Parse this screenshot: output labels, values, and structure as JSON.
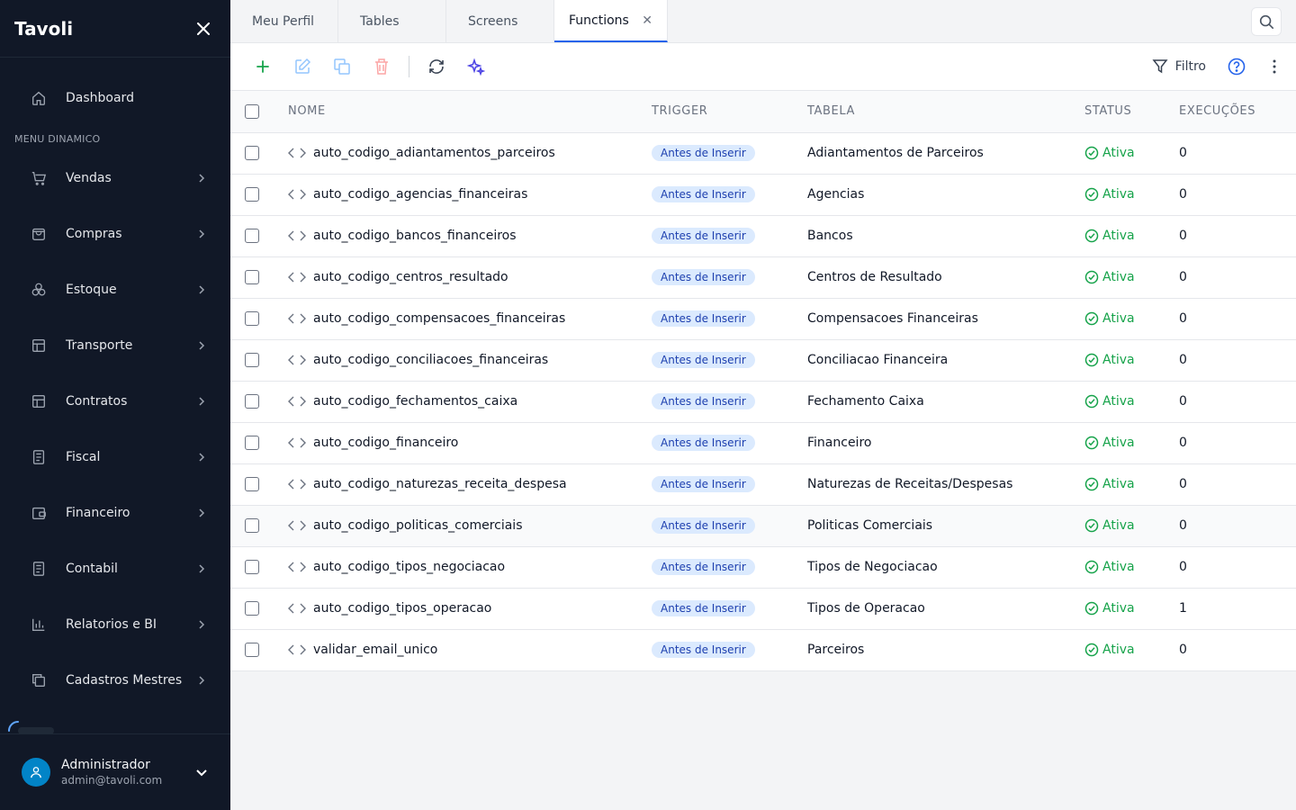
{
  "app": {
    "brand": "Tavoli"
  },
  "sidebar": {
    "dashboard": "Dashboard",
    "section_title": "MENU DINAMICO",
    "items": [
      {
        "label": "Vendas",
        "icon": "cart-icon"
      },
      {
        "label": "Compras",
        "icon": "bag-icon"
      },
      {
        "label": "Estoque",
        "icon": "boxes-icon"
      },
      {
        "label": "Transporte",
        "icon": "table-icon"
      },
      {
        "label": "Contratos",
        "icon": "table-icon"
      },
      {
        "label": "Fiscal",
        "icon": "document-icon"
      },
      {
        "label": "Financeiro",
        "icon": "wallet-icon"
      },
      {
        "label": "Contabil",
        "icon": "document-icon"
      },
      {
        "label": "Relatorios e BI",
        "icon": "bar-chart-icon"
      },
      {
        "label": "Cadastros Mestres",
        "icon": "copy-icon"
      }
    ],
    "user": {
      "name": "Administrador",
      "email": "admin@tavoli.com"
    }
  },
  "tabs": [
    {
      "label": "Meu Perfil"
    },
    {
      "label": "Tables"
    },
    {
      "label": "Screens"
    },
    {
      "label": "Functions",
      "active": true
    }
  ],
  "toolbar": {
    "filter_label": "Filtro"
  },
  "table": {
    "headers": {
      "nome": "NOME",
      "trigger": "TRIGGER",
      "tabela": "TABELA",
      "status": "STATUS",
      "execucoes": "EXECUÇÕES"
    },
    "rows": [
      {
        "nome": "auto_codigo_adiantamentos_parceiros",
        "trigger": "Antes de Inserir",
        "tabela": "Adiantamentos de Parceiros",
        "status": "Ativa",
        "execucoes": "0"
      },
      {
        "nome": "auto_codigo_agencias_financeiras",
        "trigger": "Antes de Inserir",
        "tabela": "Agencias",
        "status": "Ativa",
        "execucoes": "0"
      },
      {
        "nome": "auto_codigo_bancos_financeiros",
        "trigger": "Antes de Inserir",
        "tabela": "Bancos",
        "status": "Ativa",
        "execucoes": "0"
      },
      {
        "nome": "auto_codigo_centros_resultado",
        "trigger": "Antes de Inserir",
        "tabela": "Centros de Resultado",
        "status": "Ativa",
        "execucoes": "0"
      },
      {
        "nome": "auto_codigo_compensacoes_financeiras",
        "trigger": "Antes de Inserir",
        "tabela": "Compensacoes Financeiras",
        "status": "Ativa",
        "execucoes": "0"
      },
      {
        "nome": "auto_codigo_conciliacoes_financeiras",
        "trigger": "Antes de Inserir",
        "tabela": "Conciliacao Financeira",
        "status": "Ativa",
        "execucoes": "0"
      },
      {
        "nome": "auto_codigo_fechamentos_caixa",
        "trigger": "Antes de Inserir",
        "tabela": "Fechamento Caixa",
        "status": "Ativa",
        "execucoes": "0"
      },
      {
        "nome": "auto_codigo_financeiro",
        "trigger": "Antes de Inserir",
        "tabela": "Financeiro",
        "status": "Ativa",
        "execucoes": "0"
      },
      {
        "nome": "auto_codigo_naturezas_receita_despesa",
        "trigger": "Antes de Inserir",
        "tabela": "Naturezas de Receitas/Despesas",
        "status": "Ativa",
        "execucoes": "0"
      },
      {
        "nome": "auto_codigo_politicas_comerciais",
        "trigger": "Antes de Inserir",
        "tabela": "Politicas Comerciais",
        "status": "Ativa",
        "execucoes": "0",
        "highlighted": true
      },
      {
        "nome": "auto_codigo_tipos_negociacao",
        "trigger": "Antes de Inserir",
        "tabela": "Tipos de Negociacao",
        "status": "Ativa",
        "execucoes": "0"
      },
      {
        "nome": "auto_codigo_tipos_operacao",
        "trigger": "Antes de Inserir",
        "tabela": "Tipos de Operacao",
        "status": "Ativa",
        "execucoes": "1"
      },
      {
        "nome": "validar_email_unico",
        "trigger": "Antes de Inserir",
        "tabela": "Parceiros",
        "status": "Ativa",
        "execucoes": "0"
      }
    ]
  },
  "colors": {
    "sidebar_bg": "#111827",
    "accent": "#2563eb",
    "success": "#16a34a",
    "badge_bg": "#dbeafe"
  }
}
